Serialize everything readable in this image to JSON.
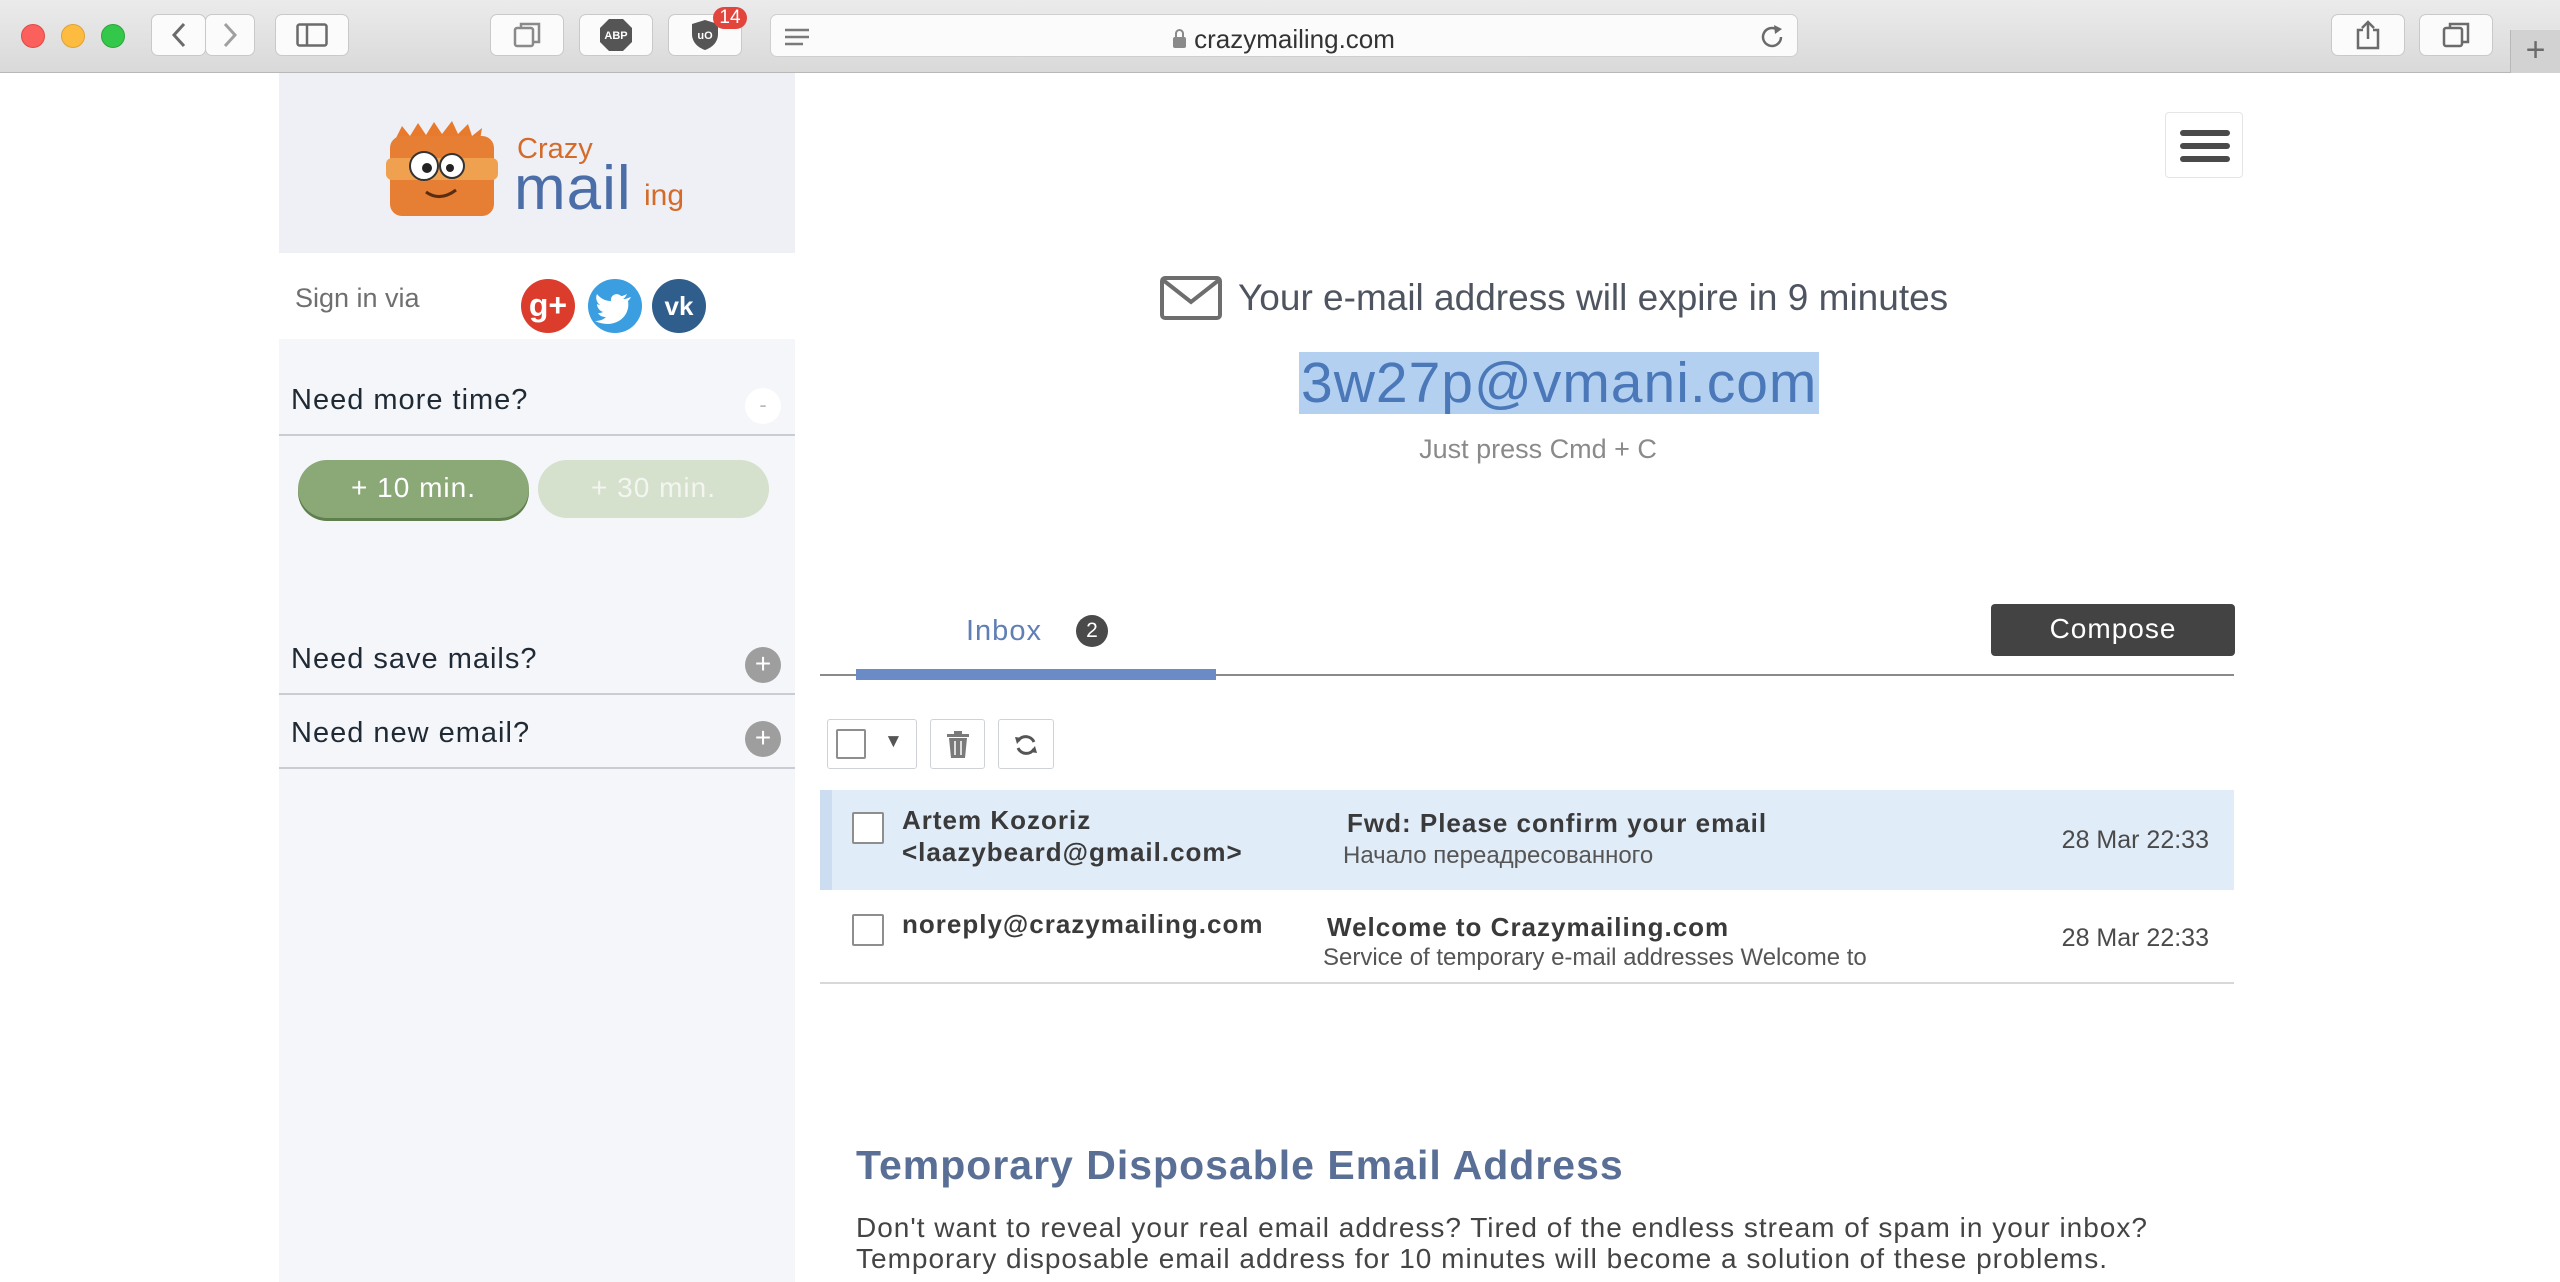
{
  "browser": {
    "url": "crazymailing.com",
    "extension_badge_count": "14",
    "abp_label": "ABP",
    "new_tab_symbol": "+"
  },
  "sidebar": {
    "logo": {
      "crazy": "Crazy",
      "mail": "mail",
      "ing": "ing"
    },
    "signin_label": "Sign in via",
    "social": {
      "google": "g+",
      "vk": "vk"
    },
    "sections": [
      {
        "label": "Need more time?",
        "toggle": "-"
      },
      {
        "label": "Need save mails?",
        "toggle": "+"
      },
      {
        "label": "Need new email?",
        "toggle": "+"
      }
    ],
    "buttons": {
      "add10": "+ 10 min.",
      "add30": "+ 30 min."
    }
  },
  "main": {
    "expire_text": "Your e-mail address will expire in 9 minutes",
    "email_address": "3w27p@vmani.com",
    "copy_hint": "Just press Cmd + C",
    "tabs": {
      "inbox_label": "Inbox",
      "inbox_count": "2"
    },
    "compose_label": "Compose",
    "toolbar": {
      "select_caret": "▼"
    },
    "mails": [
      {
        "from": "Artem Kozoriz <laazybeard@gmail.com>",
        "subject": "Fwd: Please confirm your email",
        "preview": "Начало переадресованного",
        "date": "28 Mar 22:33"
      },
      {
        "from": "noreply@crazymailing.com",
        "subject": "Welcome to Crazymailing.com",
        "preview": "Service of temporary e-mail addresses Welcome to",
        "date": "28 Mar 22:33"
      }
    ],
    "seo": {
      "title": "Temporary Disposable Email Address",
      "text": "Don't want to reveal your real email address? Tired of the endless stream of spam in your inbox? Temporary disposable email address for 10 minutes will become a solution of these problems."
    }
  },
  "colors": {
    "accent_blue": "#6a8bc6",
    "green_button": "#8ba877",
    "compose_bg": "#434343",
    "selected_row": "#e1ecf9",
    "email_highlight": "#b4d0f0"
  }
}
